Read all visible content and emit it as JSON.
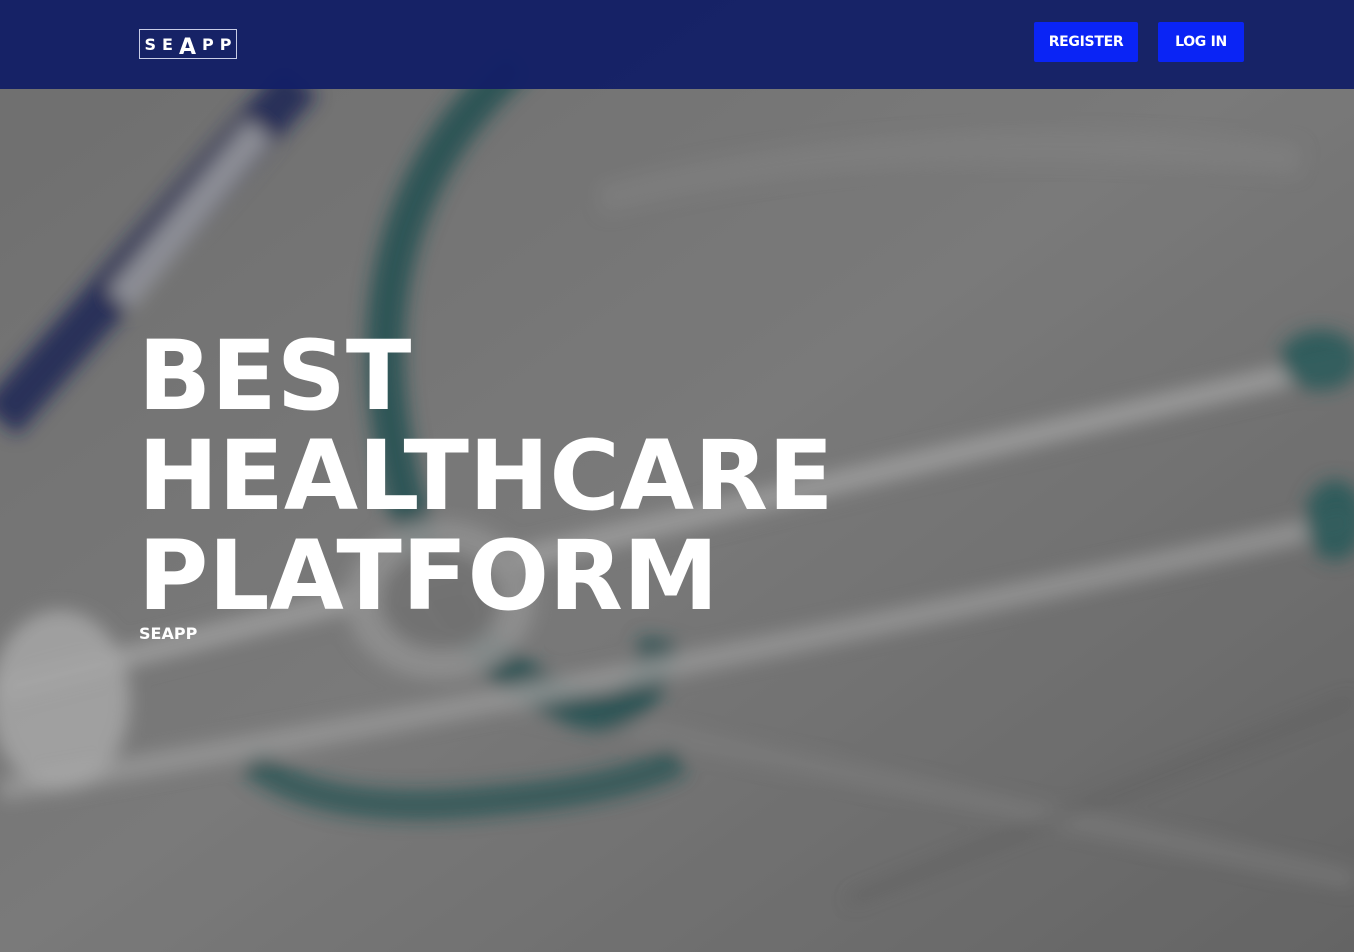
{
  "navbar": {
    "logo_text": "SEAPP",
    "register_label": "REGISTER",
    "login_label": "LOG IN"
  },
  "hero": {
    "title_lines": [
      "BEST",
      "HEALTHCARE",
      "PLATFORM"
    ],
    "subtitle": "SEAPP"
  },
  "colors": {
    "navbar_bg": "#142066",
    "button_bg": "#0a24f5",
    "text": "#ffffff"
  }
}
